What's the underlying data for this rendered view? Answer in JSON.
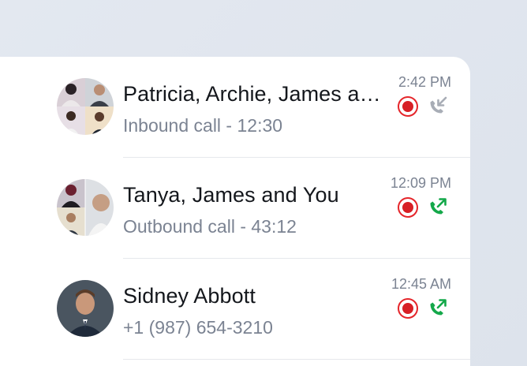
{
  "colors": {
    "recording": "#d71f25",
    "inbound_call": "#a8adb6",
    "outbound_call": "#14a84a",
    "primary_text": "#14171c",
    "secondary_text": "#7b8392"
  },
  "calls": [
    {
      "name": "Patricia, Archie, James and You",
      "detail": "Inbound call - 12:30",
      "time": "2:42 PM",
      "direction": "inbound",
      "avatar": "group-4-avatar",
      "recording": true
    },
    {
      "name": "Tanya, James and You",
      "detail": "Outbound call - 43:12",
      "time": "12:09 PM",
      "direction": "outbound",
      "avatar": "group-3-avatar",
      "recording": true
    },
    {
      "name": "Sidney Abbott",
      "detail": "+1 (987) 654-3210",
      "time": "12:45 AM",
      "direction": "outbound",
      "avatar": "single-avatar",
      "recording": true
    }
  ]
}
